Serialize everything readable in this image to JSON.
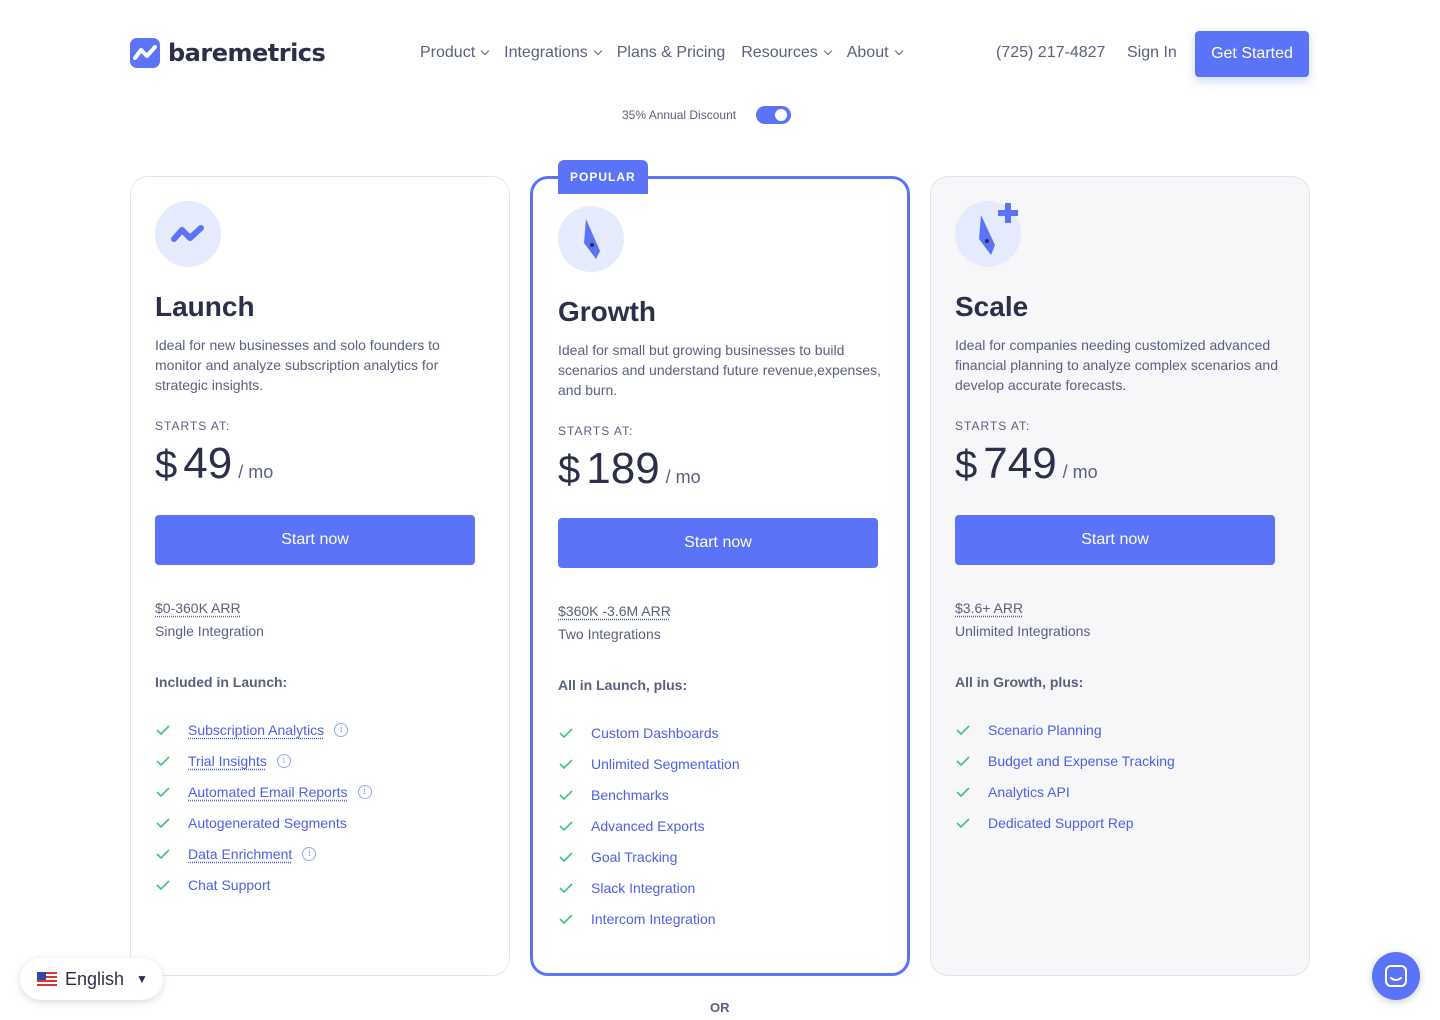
{
  "brand": {
    "name": "baremetrics",
    "accent": "#5b73f7"
  },
  "nav": {
    "items": [
      {
        "label": "Product",
        "dropdown": true
      },
      {
        "label": "Integrations",
        "dropdown": true
      },
      {
        "label": "Plans & Pricing",
        "dropdown": false
      },
      {
        "label": "Resources",
        "dropdown": true
      },
      {
        "label": "About",
        "dropdown": true
      }
    ],
    "phone": "(725) 217-4827",
    "signin": "Sign In",
    "cta": "Get Started"
  },
  "discount": {
    "label": "35% Annual Discount",
    "enabled": true
  },
  "plans": [
    {
      "name": "Launch",
      "desc": "Ideal for new businesses and solo founders to monitor and analyze subscription analytics for strategic insights.",
      "starts": "STARTS AT:",
      "currency": "$",
      "price": "49",
      "period": "/ mo",
      "button": "Start now",
      "arr": "$0-360K ARR",
      "integrations": "Single Integration",
      "included": "Included in Launch:",
      "features": [
        "Subscription Analytics",
        "Trial Insights",
        "Automated Email Reports",
        "Autogenerated Segments",
        "Data Enrichment",
        "Chat Support"
      ]
    },
    {
      "name": "Growth",
      "badge": "POPULAR",
      "desc": "Ideal for small but growing businesses to build scenarios and understand future revenue,expenses, and burn.",
      "starts": "STARTS AT:",
      "currency": "$",
      "price": "189",
      "period": "/ mo",
      "button": "Start now",
      "arr": "$360K -3.6M ARR",
      "integrations": "Two Integrations",
      "included": "All in Launch, plus:",
      "features": [
        "Custom Dashboards",
        "Unlimited Segmentation",
        "Benchmarks",
        "Advanced Exports",
        "Goal Tracking",
        "Slack Integration",
        "Intercom Integration"
      ]
    },
    {
      "name": "Scale",
      "desc": "Ideal for companies needing customized advanced financial planning to analyze complex scenarios and develop accurate forecasts.",
      "starts": "STARTS AT:",
      "currency": "$",
      "price": "749",
      "period": "/ mo",
      "button": "Start now",
      "arr": "$3.6+ ARR",
      "integrations": "Unlimited Integrations",
      "included": "All in Growth, plus:",
      "features": [
        "Scenario Planning",
        "Budget and Expense Tracking",
        "Analytics API",
        "Dedicated Support Rep"
      ]
    }
  ],
  "or": "OR",
  "language": {
    "label": "English"
  }
}
